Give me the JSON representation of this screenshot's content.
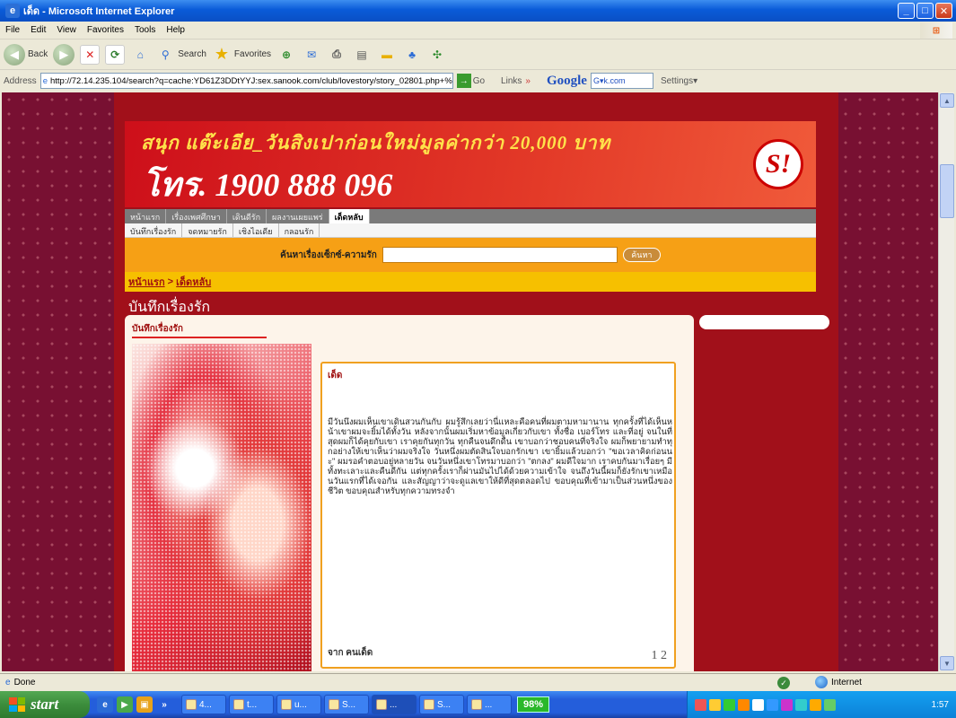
{
  "window": {
    "title": "เด็ด - Microsoft Internet Explorer"
  },
  "menu": [
    "File",
    "Edit",
    "View",
    "Favorites",
    "Tools",
    "Help"
  ],
  "toolbar": {
    "back": "Back",
    "search": "Search",
    "favorites": "Favorites"
  },
  "address": {
    "label": "Address",
    "url": "http://72.14.235.104/search?q=cache:YD61Z3DDtYYJ:sex.sanook.com/club/lovestory/story_02801.php+%U",
    "go": "Go",
    "links": "Links",
    "google": "Google",
    "search_value": "G▾k.com",
    "settings": "Settings▾"
  },
  "page": {
    "banner_line1": "สนุก แต๊ะเอีย_วันสิงเปาก่อนใหม่มูลค่ากว่า 20,000 บาท",
    "banner_line2": "โทร. 1900 888 096",
    "logo": "S!",
    "nav_tabs": [
      "หน้าแรก",
      "เรื่องเพศศึกษา",
      "เดินดีรัก",
      "ผลงานเผยแพร่",
      "เด็ดหลับ"
    ],
    "subnav": [
      "บันทึกเรื่องรัก",
      "จดหมายรัก",
      "เชิงไอเดีย",
      "กลอนรัก"
    ],
    "search_label": "ค้นหาเรื่องเซ็กซ์-ความรัก",
    "search_button": "ค้นหา",
    "breadcrumb_home": "หน้าแรก",
    "breadcrumb_sep": " > ",
    "breadcrumb_current": "เด็ดหลับ",
    "section_title": "บันทึกเรื่องรัก",
    "content_title": "บันทึกเรื่องรัก",
    "story_heading": "เด็ด",
    "story_body": "มีวันนึงผมเห็นเขาเดินสวนกันกับ ผมรู้สึกเลยว่านี่แหละคือคนที่ผมตามหามานาน ทุกครั้งที่ได้เห็นหน้าเขาผมจะยิ้มได้ทั้งวัน หลังจากนั้นผมเริ่มหาข้อมูลเกี่ยวกับเขา ทั้งชื่อ เบอร์โทร และที่อยู่ จนในที่สุดผมก็ได้คุยกับเขา เราคุยกันทุกวัน ทุกคืนจนดึกดื่น เขาบอกว่าชอบคนที่จริงใจ ผมก็พยายามทำทุกอย่างให้เขาเห็นว่าผมจริงใจ วันหนึ่งผมตัดสินใจบอกรักเขา เขายิ้มแล้วบอกว่า \"ขอเวลาคิดก่อนนะ\" ผมรอคำตอบอยู่หลายวัน จนวันหนึ่งเขาโทรมาบอกว่า \"ตกลง\" ผมดีใจมาก เราคบกันมาเรื่อยๆ มีทั้งทะเลาะและคืนดีกัน แต่ทุกครั้งเราก็ผ่านมันไปได้ด้วยความเข้าใจ จนถึงวันนี้ผมก็ยังรักเขาเหมือนวันแรกที่ได้เจอกัน และสัญญาว่าจะดูแลเขาให้ดีที่สุดตลอดไป ขอบคุณที่เข้ามาเป็นส่วนหนึ่งของชีวิต ขอบคุณสำหรับทุกความทรงจำ",
    "story_footer": "จาก คนเด็ด",
    "story_pages": "1 2"
  },
  "status": {
    "left": "Done",
    "zone": "Internet"
  },
  "taskbar": {
    "start": "start",
    "tasks": [
      "4...",
      "t...",
      "u...",
      "S...",
      "...",
      "S...",
      "..."
    ],
    "percent": "98%",
    "clock": "1:57"
  }
}
